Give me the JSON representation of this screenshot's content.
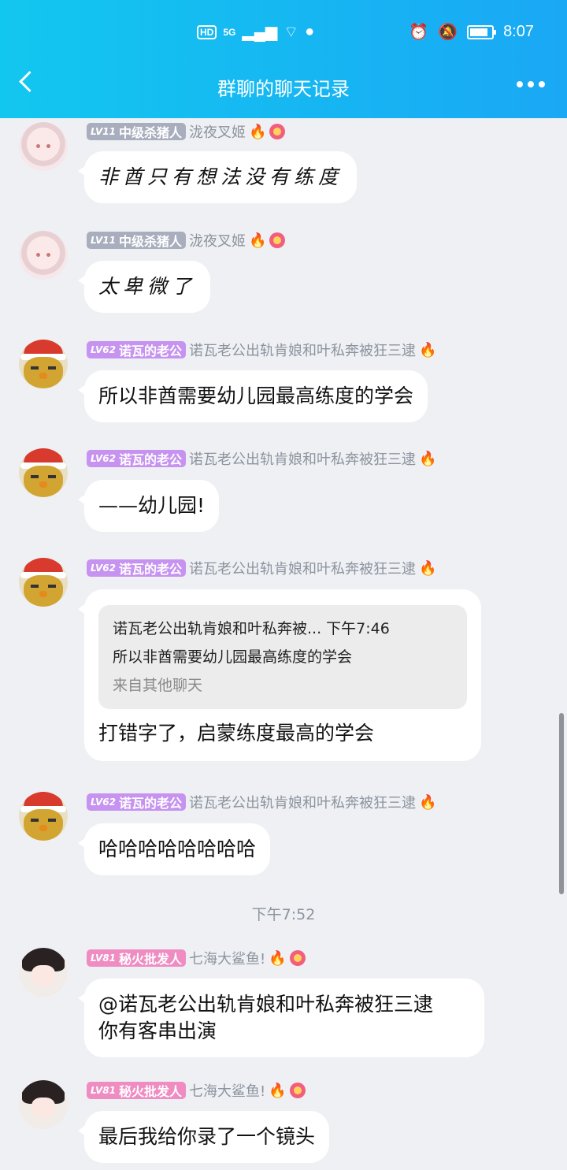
{
  "status_bar": {
    "left_icons": [
      "hd-icon",
      "5g-signal-icon",
      "wifi-icon",
      "wechat-icon"
    ],
    "hd": "HD",
    "network": "5G",
    "time": "8:07"
  },
  "header": {
    "title": "群聊的聊天记录"
  },
  "messages": [
    {
      "level": "LV11",
      "title": "中级杀猪人",
      "nickname": "泷夜叉姬",
      "text": "非酋只有想法没有练度",
      "handwritten": true
    },
    {
      "level": "LV11",
      "title": "中级杀猪人",
      "nickname": "泷夜叉姬",
      "text": "太卑微了",
      "handwritten": true
    },
    {
      "level": "LV62",
      "title": "诺瓦的老公",
      "nickname": "诺瓦老公出轨肯娘和叶私奔被狂三逮",
      "text": "所以非酋需要幼儿园最高练度的学会"
    },
    {
      "level": "LV62",
      "title": "诺瓦的老公",
      "nickname": "诺瓦老公出轨肯娘和叶私奔被狂三逮",
      "text": "——幼儿园!"
    },
    {
      "level": "LV62",
      "title": "诺瓦的老公",
      "nickname": "诺瓦老公出轨肯娘和叶私奔被狂三逮",
      "quote": {
        "header": "诺瓦老公出轨肯娘和叶私奔被... 下午7:46",
        "text": "所以非酋需要幼儿园最高练度的学会",
        "source": "来自其他聊天"
      },
      "text": "打错字了，启蒙练度最高的学会"
    },
    {
      "level": "LV62",
      "title": "诺瓦的老公",
      "nickname": "诺瓦老公出轨肯娘和叶私奔被狂三逮",
      "text": "哈哈哈哈哈哈哈哈"
    },
    {
      "level": "LV81",
      "title": "秘火批发人",
      "nickname": "七海大鲨鱼!",
      "text_line1": "@诺瓦老公出轨肯娘和叶私奔被狂三逮",
      "text_line2": "你有客串出演"
    },
    {
      "level": "LV81",
      "title": "秘火批发人",
      "nickname": "七海大鲨鱼!",
      "text": "最后我给你录了一个镜头"
    }
  ],
  "time_separator": "下午7:52"
}
